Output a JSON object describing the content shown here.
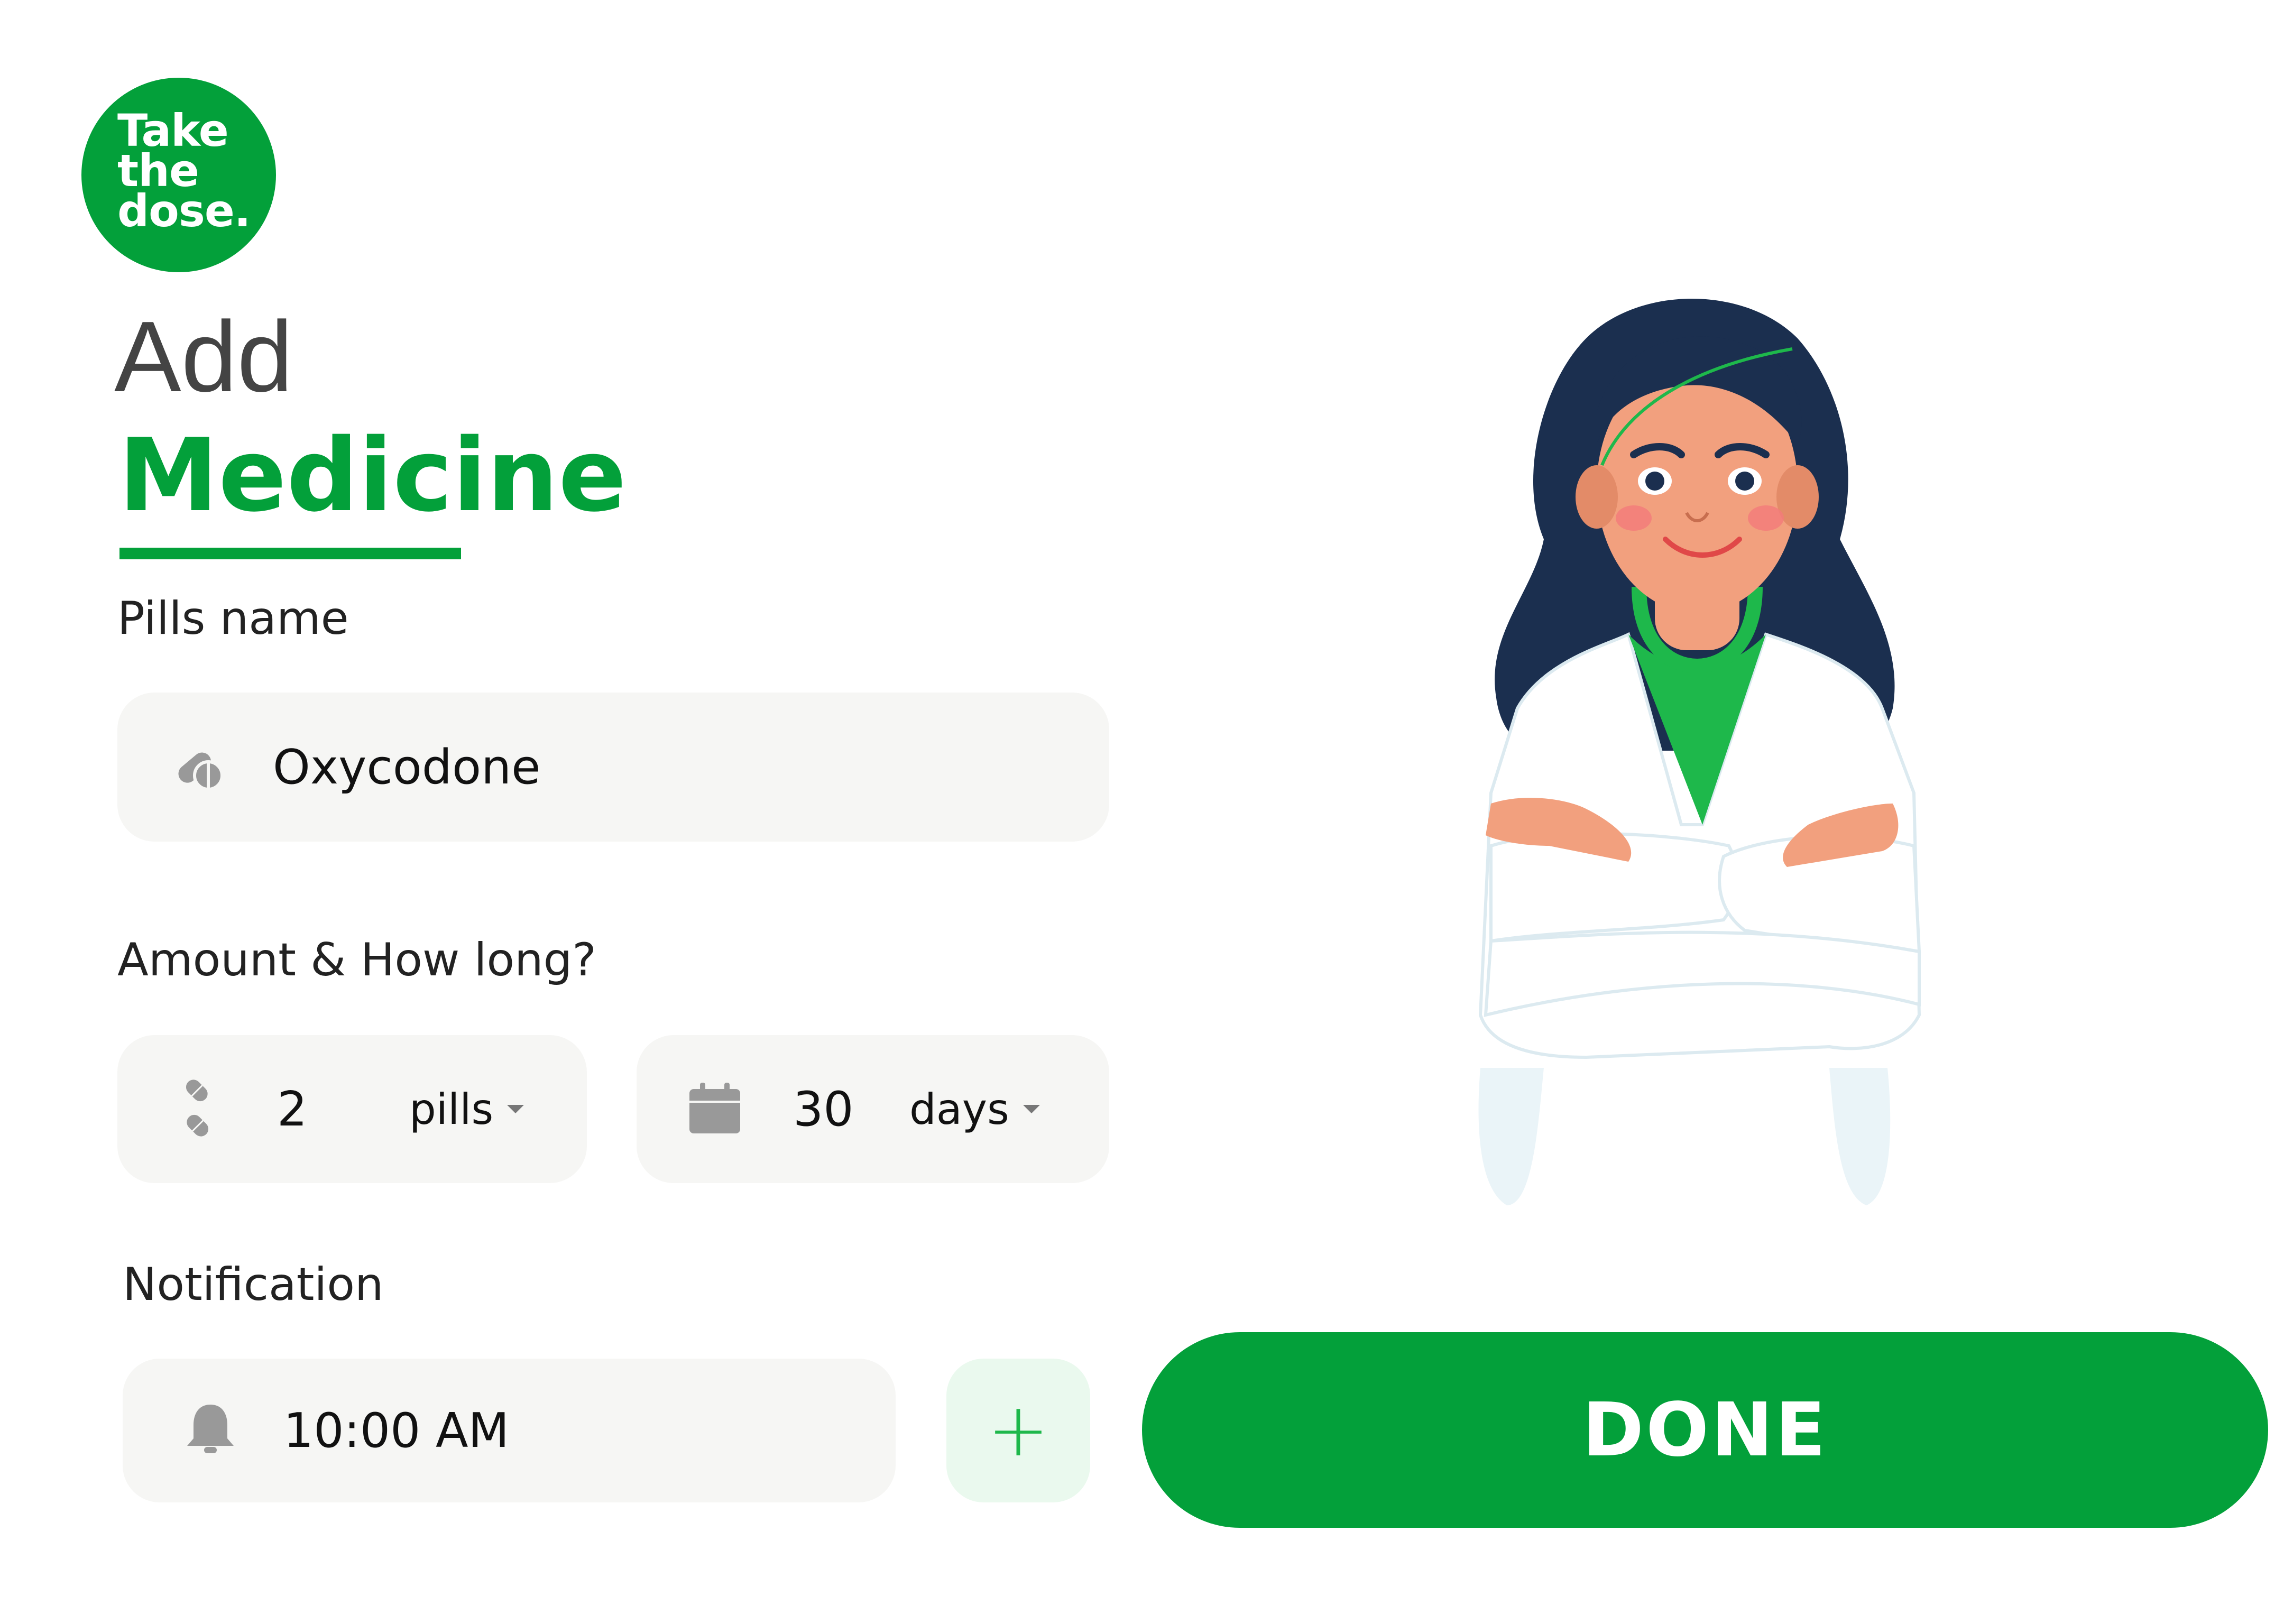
{
  "brand": {
    "logo_lines": [
      "Take",
      "the",
      "dose."
    ],
    "accent_color": "#03A03A"
  },
  "header": {
    "title_line1": "Add",
    "title_line2": "Medicine"
  },
  "pills_section": {
    "label": "Pills name",
    "icon": "pill-capsule-icon",
    "value": "Oxycodone"
  },
  "amount_section": {
    "label": "Amount & How long?",
    "amount": {
      "icon": "pills-icon",
      "value": "2",
      "unit": "pills"
    },
    "duration": {
      "icon": "calendar-icon",
      "value": "30",
      "unit": "days"
    }
  },
  "notification_section": {
    "label": "Notification",
    "icon": "bell-icon",
    "time": "10:00 AM",
    "add_label": "+"
  },
  "actions": {
    "done_label": "DONE"
  },
  "illustration": {
    "description_icon": "doctor-illustration"
  }
}
